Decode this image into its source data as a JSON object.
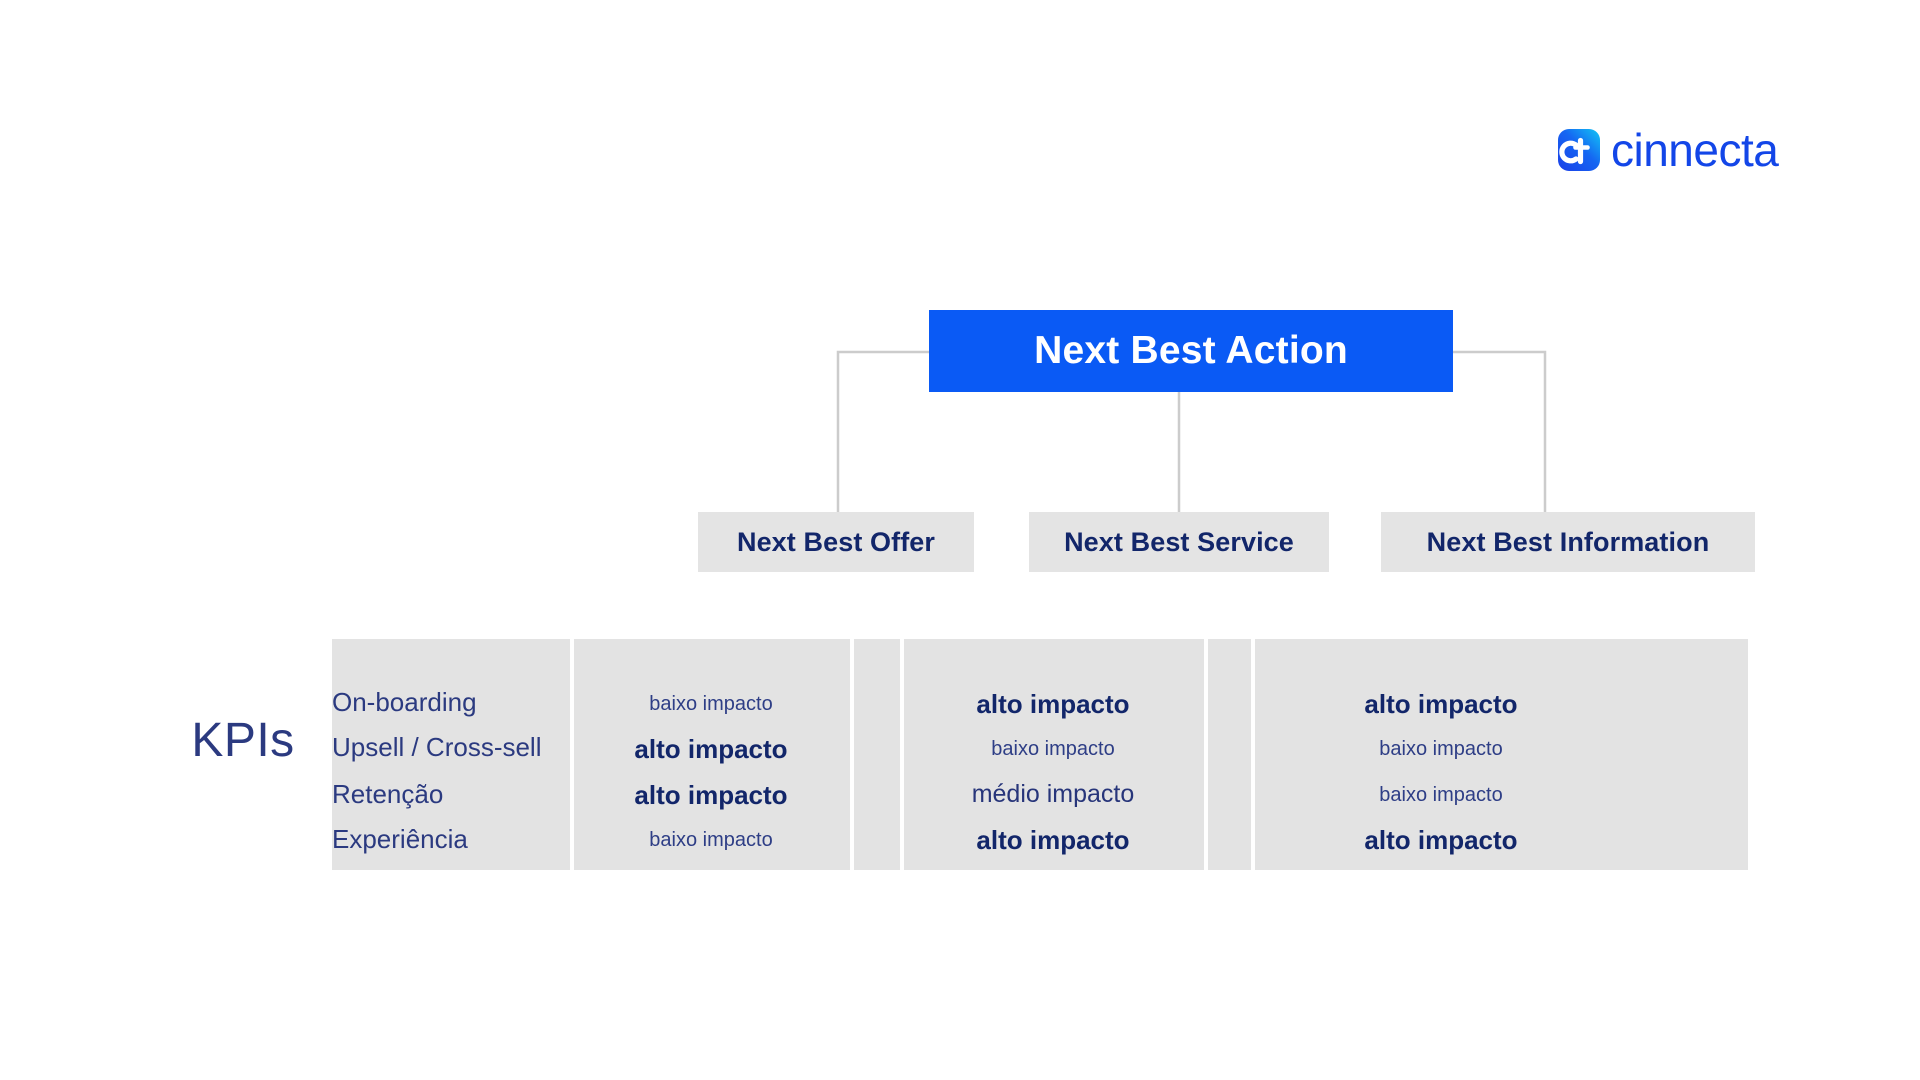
{
  "brand": {
    "logo_icon": "cinnecta-logo-icon",
    "name": "cinnecta",
    "mark_color_start": "#1B4DF0",
    "mark_color_end": "#12C6F5",
    "word_color": "#1346E8"
  },
  "diagram": {
    "root": {
      "label": "Next Best Action",
      "bg_color": "#0A5AF5",
      "text_color": "#FFFFFF"
    },
    "children": [
      {
        "label": "Next Best Offer",
        "bg_color": "#E4E4E4",
        "text_color": "#12266A"
      },
      {
        "label": "Next Best Service",
        "bg_color": "#E4E4E4",
        "text_color": "#12266A"
      },
      {
        "label": "Next Best Information",
        "bg_color": "#E4E4E4",
        "text_color": "#12266A"
      }
    ],
    "connector_color": "#CCCCCC"
  },
  "kpi_section": {
    "title": "KPIs",
    "panel_bg": "#E3E3E3",
    "row_labels": [
      "On-boarding",
      "Upsell / Cross-sell",
      "Retenção",
      "Experiência"
    ],
    "columns": [
      {
        "header": "Next Best Offer",
        "values": [
          {
            "text": "baixo impacto",
            "level": "baixo"
          },
          {
            "text": "alto impacto",
            "level": "alto"
          },
          {
            "text": "alto impacto",
            "level": "alto"
          },
          {
            "text": "baixo impacto",
            "level": "baixo"
          }
        ]
      },
      {
        "header": "Next Best Service",
        "values": [
          {
            "text": "alto impacto",
            "level": "alto"
          },
          {
            "text": "baixo impacto",
            "level": "baixo"
          },
          {
            "text": "médio impacto",
            "level": "medio"
          },
          {
            "text": "alto impacto",
            "level": "alto"
          }
        ]
      },
      {
        "header": "Next Best Information",
        "values": [
          {
            "text": "alto impacto",
            "level": "alto"
          },
          {
            "text": "baixo impacto",
            "level": "baixo"
          },
          {
            "text": "baixo impacto",
            "level": "baixo"
          },
          {
            "text": "alto impacto",
            "level": "alto"
          }
        ]
      }
    ]
  }
}
